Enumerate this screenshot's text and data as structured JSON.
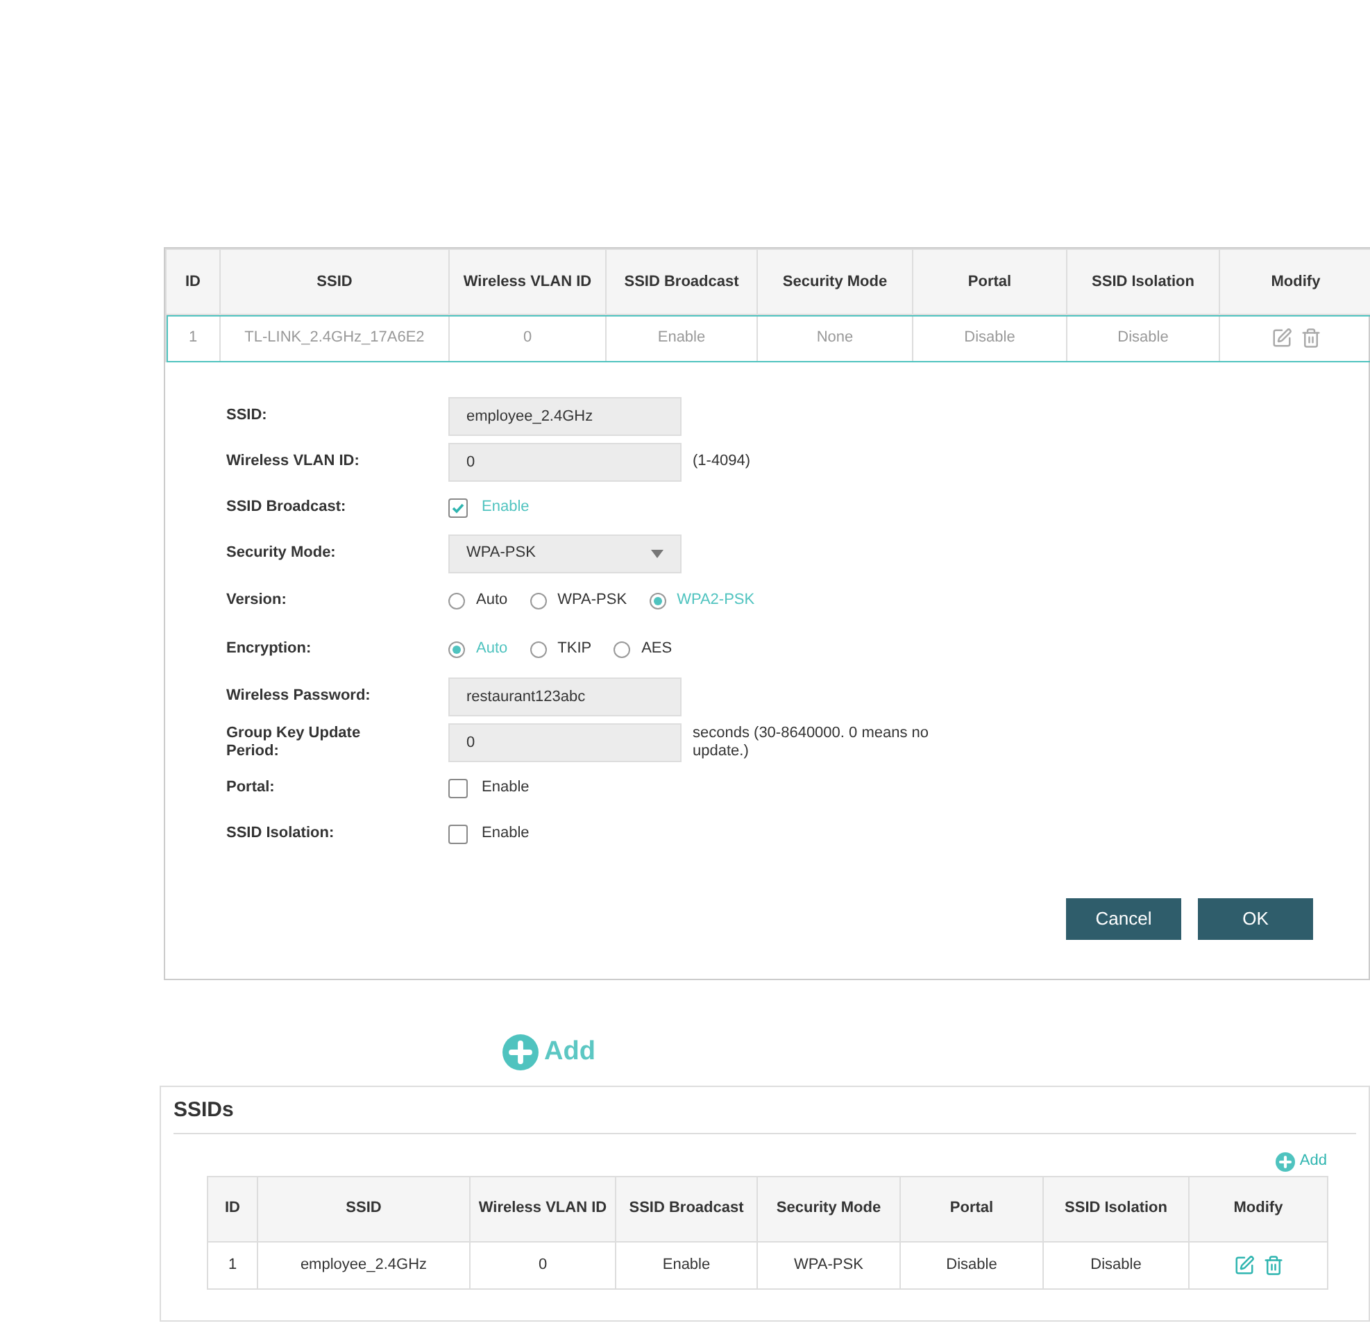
{
  "edit_table": {
    "columns": [
      "ID",
      "SSID",
      "Wireless VLAN ID",
      "SSID Broadcast",
      "Security Mode",
      "Portal",
      "SSID Isolation",
      "Modify"
    ],
    "rows": [
      {
        "editing": true,
        "cells": [
          "1",
          "TL-LINK_2.4GHz_17A6E2",
          "0",
          "Enable",
          "None",
          "Disable",
          "Disable"
        ]
      }
    ]
  },
  "form": [
    {
      "kind": "text",
      "label": "SSID:",
      "value": "employee_2.4GHz"
    },
    {
      "kind": "text",
      "label": "Wireless VLAN ID:",
      "value": "0",
      "hint": "(1-4094)"
    },
    {
      "kind": "checkbox",
      "label": "SSID Broadcast:",
      "option": "Enable",
      "checked": true
    },
    {
      "kind": "select",
      "label": "Security Mode:",
      "value": "WPA-PSK"
    },
    {
      "kind": "radio",
      "label": "Version:",
      "options": [
        {
          "label": "Auto",
          "selected": false
        },
        {
          "label": "WPA-PSK",
          "selected": false
        },
        {
          "label": "WPA2-PSK",
          "selected": true
        }
      ]
    },
    {
      "kind": "radio",
      "label": "Encryption:",
      "options": [
        {
          "label": "Auto",
          "selected": true
        },
        {
          "label": "TKIP",
          "selected": false
        },
        {
          "label": "AES",
          "selected": false
        }
      ]
    },
    {
      "kind": "text",
      "label": "Wireless Password:",
      "value": "restaurant123abc"
    },
    {
      "kind": "text",
      "label": "Group Key Update Period:",
      "value": "0",
      "hint": "seconds (30-8640000. 0 means no update.)"
    },
    {
      "kind": "checkbox",
      "label": "Portal:",
      "option": "Enable",
      "checked": false
    },
    {
      "kind": "checkbox",
      "label": "SSID Isolation:",
      "option": "Enable",
      "checked": false
    }
  ],
  "buttons": [
    "Cancel",
    "OK"
  ],
  "add_link": "Add",
  "ssids_panel": {
    "title": "SSIDs",
    "add_link": "Add",
    "table": {
      "columns": [
        "ID",
        "SSID",
        "Wireless VLAN ID",
        "SSID Broadcast",
        "Security Mode",
        "Portal",
        "SSID Isolation",
        "Modify"
      ],
      "rows": [
        {
          "editing": false,
          "cells": [
            "1",
            "employee_2.4GHz",
            "0",
            "Enable",
            "WPA-PSK",
            "Disable",
            "Disable"
          ]
        }
      ]
    }
  }
}
